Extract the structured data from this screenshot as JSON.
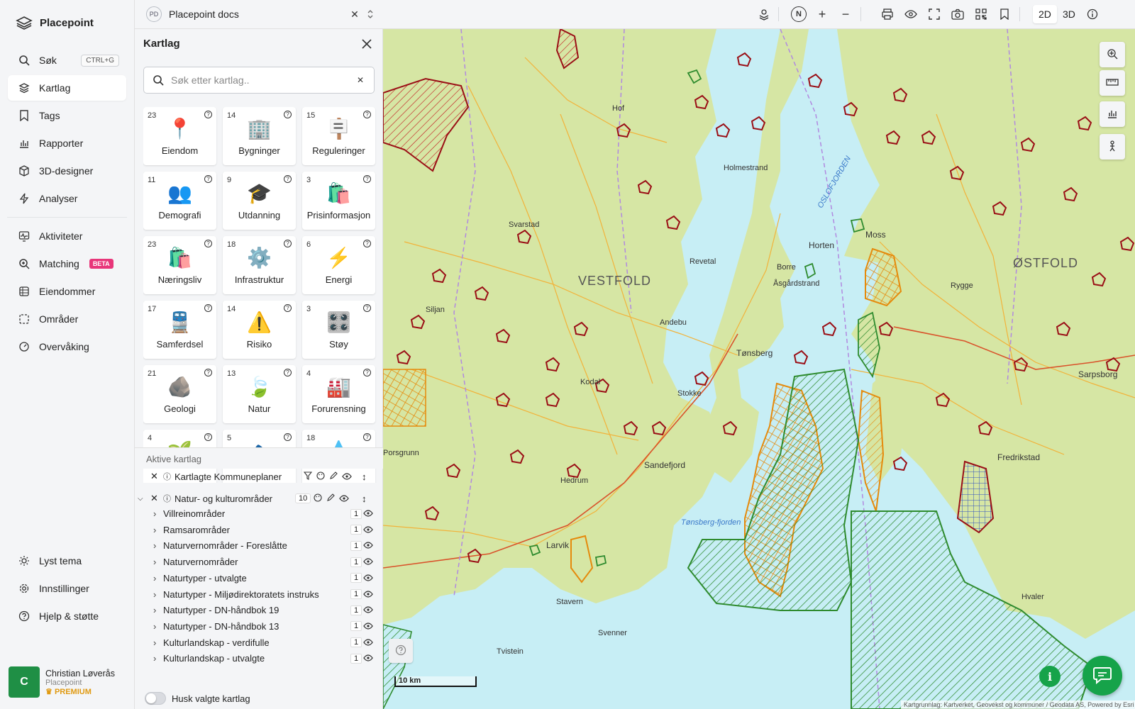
{
  "app": {
    "name": "Placepoint"
  },
  "nav": {
    "search": {
      "label": "Søk",
      "shortcut": "CTRL+G"
    },
    "items": [
      {
        "label": "Kartlag"
      },
      {
        "label": "Tags"
      },
      {
        "label": "Rapporter"
      },
      {
        "label": "3D-designer"
      },
      {
        "label": "Analyser"
      }
    ],
    "items2": [
      {
        "label": "Aktiviteter"
      },
      {
        "label": "Matching",
        "badge": "BETA"
      },
      {
        "label": "Eiendommer"
      },
      {
        "label": "Områder"
      },
      {
        "label": "Overvåking"
      }
    ],
    "bottom": [
      {
        "label": "Lyst tema"
      },
      {
        "label": "Innstillinger"
      },
      {
        "label": "Hjelp & støtte"
      }
    ]
  },
  "user": {
    "initial": "C",
    "name": "Christian Løverås",
    "org": "Placepoint",
    "plan": "PREMIUM"
  },
  "topbar": {
    "doc_badge": "PD",
    "doc_title": "Placepoint docs",
    "compass": "N",
    "mode_2d": "2D",
    "mode_3d": "3D"
  },
  "panel": {
    "title": "Kartlag",
    "search_placeholder": "Søk etter kartlag..",
    "categories": [
      {
        "count": "23",
        "label": "Eiendom",
        "icon": "📍"
      },
      {
        "count": "14",
        "label": "Bygninger",
        "icon": "🏢"
      },
      {
        "count": "15",
        "label": "Reguleringer",
        "icon": "🪧"
      },
      {
        "count": "11",
        "label": "Demografi",
        "icon": "👥"
      },
      {
        "count": "9",
        "label": "Utdanning",
        "icon": "🎓"
      },
      {
        "count": "3",
        "label": "Prisinformasjon",
        "icon": "🛍️"
      },
      {
        "count": "23",
        "label": "Næringsliv",
        "icon": "🛍️"
      },
      {
        "count": "18",
        "label": "Infrastruktur",
        "icon": "⚙️"
      },
      {
        "count": "6",
        "label": "Energi",
        "icon": "⚡"
      },
      {
        "count": "17",
        "label": "Samferdsel",
        "icon": "🚆"
      },
      {
        "count": "14",
        "label": "Risiko",
        "icon": "⚠️"
      },
      {
        "count": "3",
        "label": "Støy",
        "icon": "🎛️"
      },
      {
        "count": "21",
        "label": "Geologi",
        "icon": "🪨"
      },
      {
        "count": "13",
        "label": "Natur",
        "icon": "🍃"
      },
      {
        "count": "4",
        "label": "Forurensning",
        "icon": "🏭"
      },
      {
        "count": "4",
        "label": "",
        "icon": "🌱"
      },
      {
        "count": "5",
        "label": "",
        "icon": "🐟"
      },
      {
        "count": "18",
        "label": "",
        "icon": "💧"
      }
    ],
    "active_title": "Aktive kartlag",
    "group1": {
      "name": "Kartlagte Kommuneplaner"
    },
    "group2": {
      "name": "Natur- og kulturområder",
      "count": "10"
    },
    "layers": [
      {
        "name": "Villreinområder",
        "count": "1"
      },
      {
        "name": "Ramsarområder",
        "count": "1"
      },
      {
        "name": "Naturvernområder - Foreslåtte",
        "count": "1"
      },
      {
        "name": "Naturvernområder",
        "count": "1"
      },
      {
        "name": "Naturtyper - utvalgte",
        "count": "1"
      },
      {
        "name": "Naturtyper - Miljødirektoratets instruks",
        "count": "1"
      },
      {
        "name": "Naturtyper - DN-håndbok 19",
        "count": "1"
      },
      {
        "name": "Naturtyper - DN-håndbok 13",
        "count": "1"
      },
      {
        "name": "Kulturlandskap - verdifulle",
        "count": "1"
      },
      {
        "name": "Kulturlandskap - utvalgte",
        "count": "1"
      }
    ],
    "remember_label": "Husk valgte kartlag"
  },
  "map": {
    "labels": {
      "vestfold": "VESTFOLD",
      "ostfold": "ØSTFOLD",
      "oslofjorden": "OSLOFJORDEN",
      "horten": "Horten",
      "tonsberg": "Tønsberg",
      "sandefjord": "Sandefjord",
      "larvik": "Larvik",
      "holmestrand": "Holmestrand",
      "porsgrunn": "Porsgrunn",
      "fredrikstad": "Fredrikstad",
      "sarpsborg": "Sarpsborg",
      "moss": "Moss",
      "revetal": "Revetal",
      "andebu": "Andebu",
      "hof": "Hof",
      "svarstad": "Svarstad",
      "siljan": "Siljan",
      "stavern": "Stavern",
      "tvistein": "Tvistein",
      "svenner": "Svenner",
      "hvaler": "Hvaler",
      "stokke": "Stokke",
      "kodal": "Kodal",
      "hedrum": "Hedrum",
      "borre": "Borre",
      "asgardstrand": "Åsgårdstrand",
      "rygge": "Rygge",
      "tonsbergfjorden": "Tønsberg-fjorden"
    },
    "scale": "10 km",
    "attribution": "Kartgrunnlag: Kartverket, Geovekst og kommuner / Geodata AS, Powered by Esri"
  }
}
